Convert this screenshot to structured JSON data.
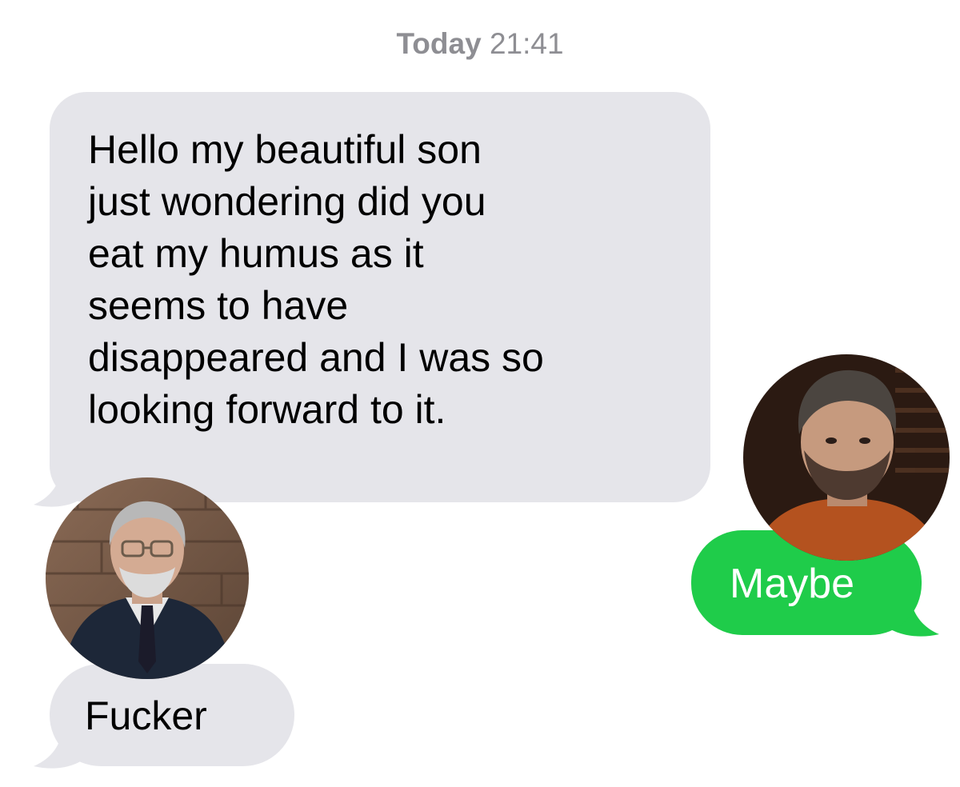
{
  "timestamp": {
    "day": "Today",
    "time": "21:41"
  },
  "messages": [
    {
      "direction": "incoming",
      "text": "Hello my beautiful son\njust wondering did you\neat my humus as it\nseems to have\ndisappeared and I was so\nlooking forward to it."
    },
    {
      "direction": "outgoing",
      "text": "Maybe"
    },
    {
      "direction": "incoming",
      "text": "Fucker"
    }
  ],
  "colors": {
    "incoming_bubble": "#e5e5ea",
    "outgoing_bubble": "#1fcc4a",
    "timestamp_text": "#8e8e93",
    "background": "#ffffff"
  },
  "avatars": [
    {
      "name": "avatar-older-man-photo",
      "depicts": "older man with glasses and suit"
    },
    {
      "name": "avatar-bearded-man-photo",
      "depicts": "bearded man in orange shirt"
    }
  ]
}
